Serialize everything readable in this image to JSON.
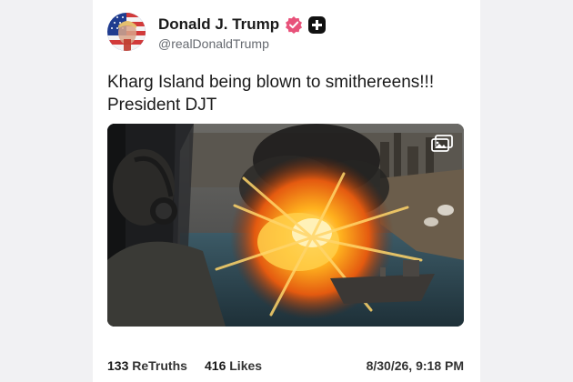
{
  "author": {
    "display_name": "Donald J. Trump",
    "handle": "@realDonaldTrump",
    "avatar_icon": "flag-portrait-avatar",
    "verified_icon": "verified-badge-icon",
    "verified_color": "#e8527a",
    "plus_icon": "plus-badge-icon"
  },
  "post": {
    "line1": "Kharg Island being blown to smithereens!!!",
    "line2": "President DJT",
    "media_icon": "gallery-icon"
  },
  "stats": {
    "retruths_count": "133",
    "retruths_label": "ReTruths",
    "likes_count": "416",
    "likes_label": "Likes",
    "timestamp": "8/30/26, 9:18 PM"
  }
}
